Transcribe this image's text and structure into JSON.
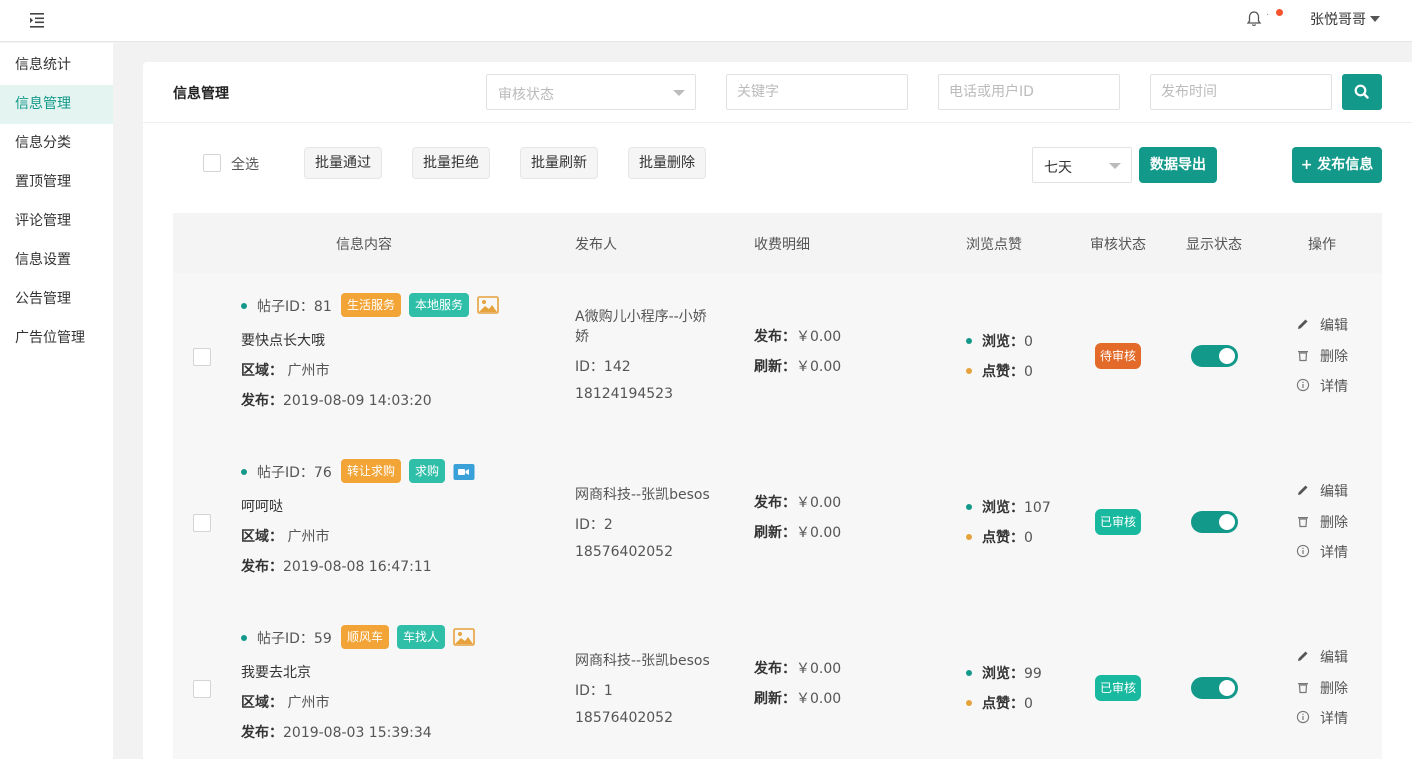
{
  "topbar": {
    "user_name": "张悦哥哥",
    "bell_separator": "·"
  },
  "sidebar": {
    "items": [
      {
        "label": "信息统计"
      },
      {
        "label": "信息管理"
      },
      {
        "label": "信息分类"
      },
      {
        "label": "置顶管理"
      },
      {
        "label": "评论管理"
      },
      {
        "label": "信息设置"
      },
      {
        "label": "公告管理"
      },
      {
        "label": "广告位管理"
      }
    ],
    "active_index": 1
  },
  "filters": {
    "title": "信息管理",
    "status_placeholder": "审核状态",
    "keyword_placeholder": "关键字",
    "phone_placeholder": "电话或用户ID",
    "time_placeholder": "发布时间"
  },
  "toolbar": {
    "select_all": "全选",
    "batch_approve": "批量通过",
    "batch_reject": "批量拒绝",
    "batch_refresh": "批量刷新",
    "batch_delete": "批量删除",
    "days_value": "七天",
    "export": "数据导出",
    "publish": "+ 发布信息"
  },
  "table": {
    "headers": [
      "信息内容",
      "发布人",
      "收费明细",
      "浏览点赞",
      "审核状态",
      "显示状态",
      "操作"
    ],
    "label_region": "区域：",
    "label_publish": "发布：",
    "label_refresh": "刷新：",
    "label_views": "浏览：",
    "label_likes": "点赞：",
    "op_edit": "编辑",
    "op_delete": "删除",
    "op_detail": "详情",
    "rows": [
      {
        "post_id": "帖子ID：81",
        "tag1": "生活服务",
        "tag2": "本地服务",
        "media": "image-icon",
        "title": "要快点长大哦",
        "region": "广州市",
        "publish_time": "2019-08-09 14:03:20",
        "publisher_line1": "A微购儿小程序--小娇",
        "publisher_line2": "娇",
        "publisher_id": "ID：142",
        "phone": "18124194523",
        "fee_publish": "￥0.00",
        "fee_refresh": "￥0.00",
        "views": "0",
        "likes": "0",
        "status": "待审核",
        "status_color": "#e36a28",
        "visible": true
      },
      {
        "post_id": "帖子ID：76",
        "tag1": "转让求购",
        "tag2": "求购",
        "media": "video-icon",
        "title": "呵呵哒",
        "region": "广州市",
        "publish_time": "2019-08-08 16:47:11",
        "publisher_line1": "网商科技--张凯besos",
        "publisher_line2": "",
        "publisher_id": "ID：2",
        "phone": "18576402052",
        "fee_publish": "￥0.00",
        "fee_refresh": "￥0.00",
        "views": "107",
        "likes": "0",
        "status": "已审核",
        "status_color": "#19b9a0",
        "visible": true
      },
      {
        "post_id": "帖子ID：59",
        "tag1": "顺风车",
        "tag2": "车找人",
        "media": "image-icon",
        "title": "我要去北京",
        "region": "广州市",
        "publish_time": "2019-08-03 15:39:34",
        "publisher_line1": "网商科技--张凯besos",
        "publisher_line2": "",
        "publisher_id": "ID：1",
        "phone": "18576402052",
        "fee_publish": "￥0.00",
        "fee_refresh": "￥0.00",
        "views": "99",
        "likes": "0",
        "status": "已审核",
        "status_color": "#19b9a0",
        "visible": true
      }
    ]
  },
  "colors": {
    "accent": "#13998a",
    "pending": "#e36a28",
    "approved": "#19b9a0",
    "tag_orange": "#f2a437",
    "tag_teal": "#2fbfa8",
    "notification_dot": "#f5532d"
  }
}
